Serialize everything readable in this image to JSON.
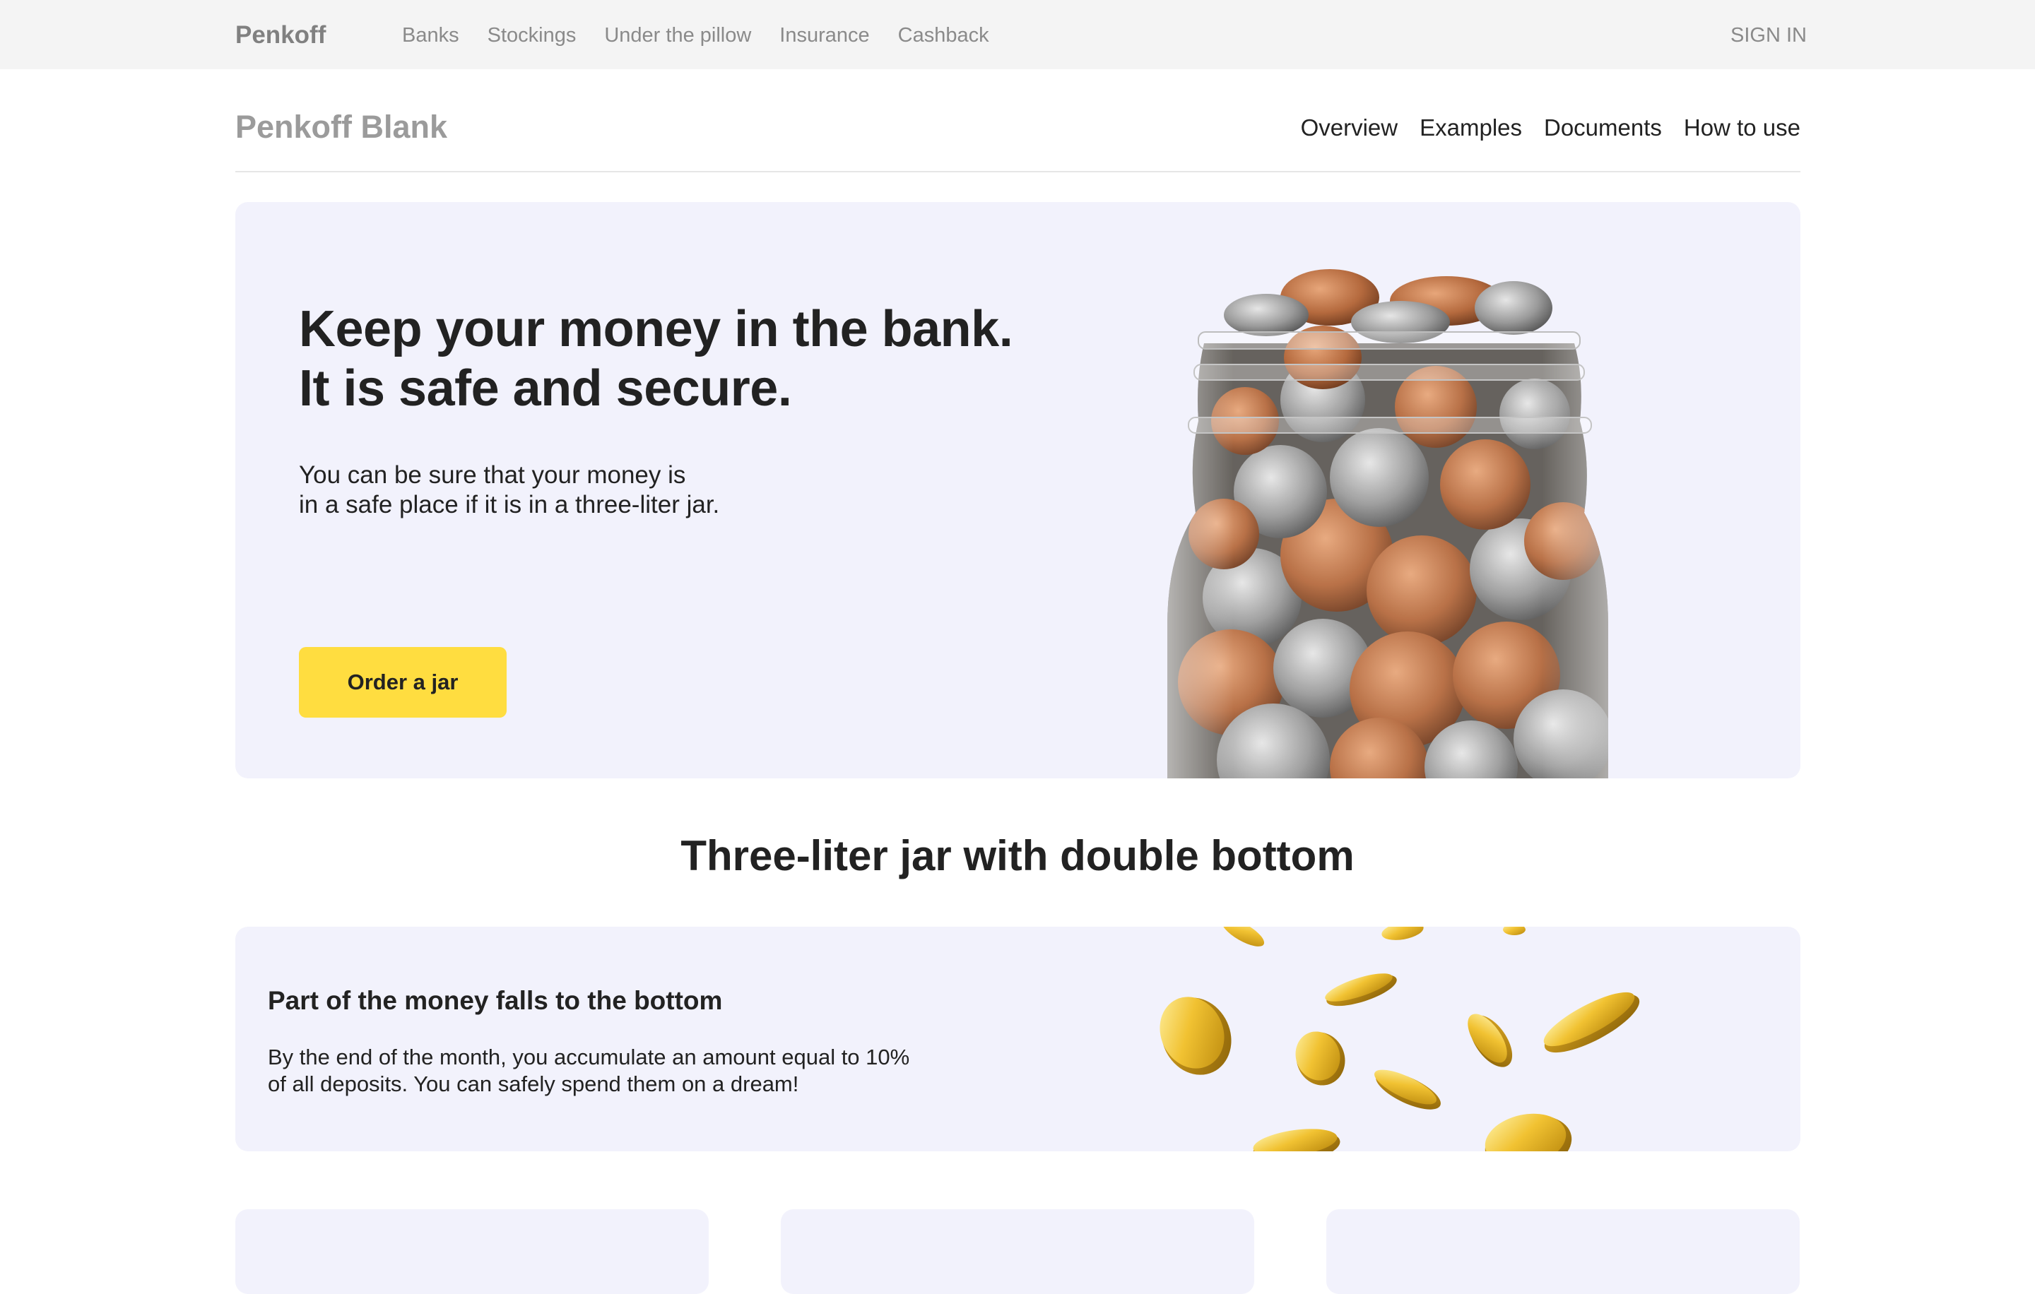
{
  "topbar": {
    "brand": "Penkoff",
    "nav": [
      "Banks",
      "Stockings",
      "Under the pillow",
      "Insurance",
      "Cashback"
    ],
    "sign_in": "SIGN IN"
  },
  "subheader": {
    "product": "Penkoff Blank",
    "nav": [
      "Overview",
      "Examples",
      "Documents",
      "How to use"
    ]
  },
  "hero": {
    "title_lines": [
      "Keep your money in the bank.",
      "It is safe and secure."
    ],
    "desc_lines": [
      "You can be sure that your money is",
      "in a safe place if it is in a three-liter jar."
    ],
    "button": "Order a jar",
    "image": "coin-jar-image"
  },
  "section": {
    "title": "Three-liter jar with double bottom"
  },
  "feature": {
    "title": "Part of the money falls to the bottom",
    "text_lines": [
      "By the end of the month, you accumulate an amount equal to 10%",
      "of all deposits. You can safely spend them on a dream!"
    ],
    "image": "falling-coins-image"
  },
  "colors": {
    "accent": "#ffdd40",
    "card_bg": "#f2f2fc",
    "topbar_bg": "#f4f4f4"
  }
}
